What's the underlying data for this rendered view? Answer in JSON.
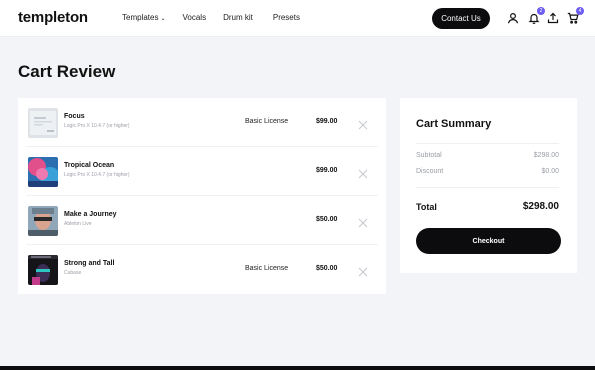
{
  "brand": {
    "logo": "templeton"
  },
  "nav": {
    "items": [
      {
        "label": "Templates",
        "has_dropdown": true
      },
      {
        "label": "Vocals"
      },
      {
        "label": "Drum kit"
      },
      {
        "label": "Presets"
      }
    ],
    "contact_label": "Contact Us",
    "notification_count": "2",
    "cart_count": "4",
    "icons": [
      "user-icon",
      "bell-icon",
      "upload-icon",
      "cart-icon"
    ]
  },
  "page": {
    "title": "Cart Review"
  },
  "cart": {
    "items": [
      {
        "title": "Focus",
        "subtitle": "Logic Pro X 10.4.7 (or higher)",
        "license": "Basic License",
        "price": "$99.00"
      },
      {
        "title": "Tropical Ocean",
        "subtitle": "Logic Pro X 10.4.7 (or higher)",
        "license": "",
        "price": "$99.00"
      },
      {
        "title": "Make a Journey",
        "subtitle": "Ableton Live",
        "license": "",
        "price": "$50.00"
      },
      {
        "title": "Strong and Tall",
        "subtitle": "Cubase",
        "license": "Basic License",
        "price": "$50.00"
      }
    ]
  },
  "summary": {
    "title": "Cart Summary",
    "subtotal_label": "Subtotal",
    "subtotal_value": "$298.00",
    "discount_label": "Discount",
    "discount_value": "$0.00",
    "total_label": "Total",
    "total_value": "$298.00",
    "checkout_label": "Checkout"
  },
  "colors": {
    "accent": "#6c5cf0",
    "button_dark": "#0c0c0e",
    "page_bg": "#f3f4f7",
    "muted_text": "#9a9ea6"
  }
}
